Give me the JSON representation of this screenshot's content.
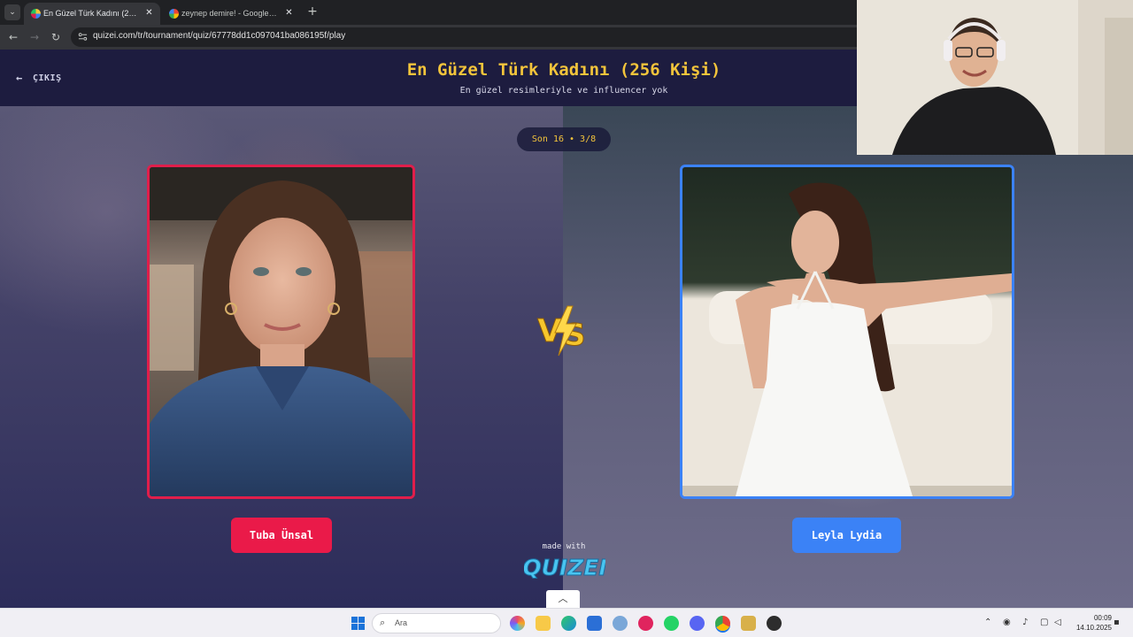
{
  "browser": {
    "tabs": [
      {
        "title": "En Güzel Türk Kadını (256 Kişi)",
        "active": true
      },
      {
        "title": "zeynep demire! - Google'da Ara",
        "active": false
      }
    ],
    "new_tab_label": "+",
    "url": "quizei.com/tr/tournament/quiz/67778dd1c097041ba086195f/play"
  },
  "header": {
    "exit_label": "ÇIKIŞ",
    "title": "En Güzel Türk Kadını (256 Kişi)",
    "subtitle": "En güzel resimleriyle ve influencer yok"
  },
  "round": {
    "label": "Son 16 • 3/8"
  },
  "contestants": {
    "left": {
      "name": "Tuba Ünsal",
      "accent": "#e01e4b"
    },
    "right": {
      "name": "Leyla Lydia",
      "accent": "#3b82f6"
    }
  },
  "vs_label": "VS",
  "footer": {
    "made_with": "made with",
    "brand": "QUIZEI"
  },
  "taskbar": {
    "search_placeholder": "Ara",
    "time": "00:09",
    "date": "14.10.2025"
  },
  "colors": {
    "title": "#f3c43b",
    "header_bg": "#1d1c3f"
  }
}
